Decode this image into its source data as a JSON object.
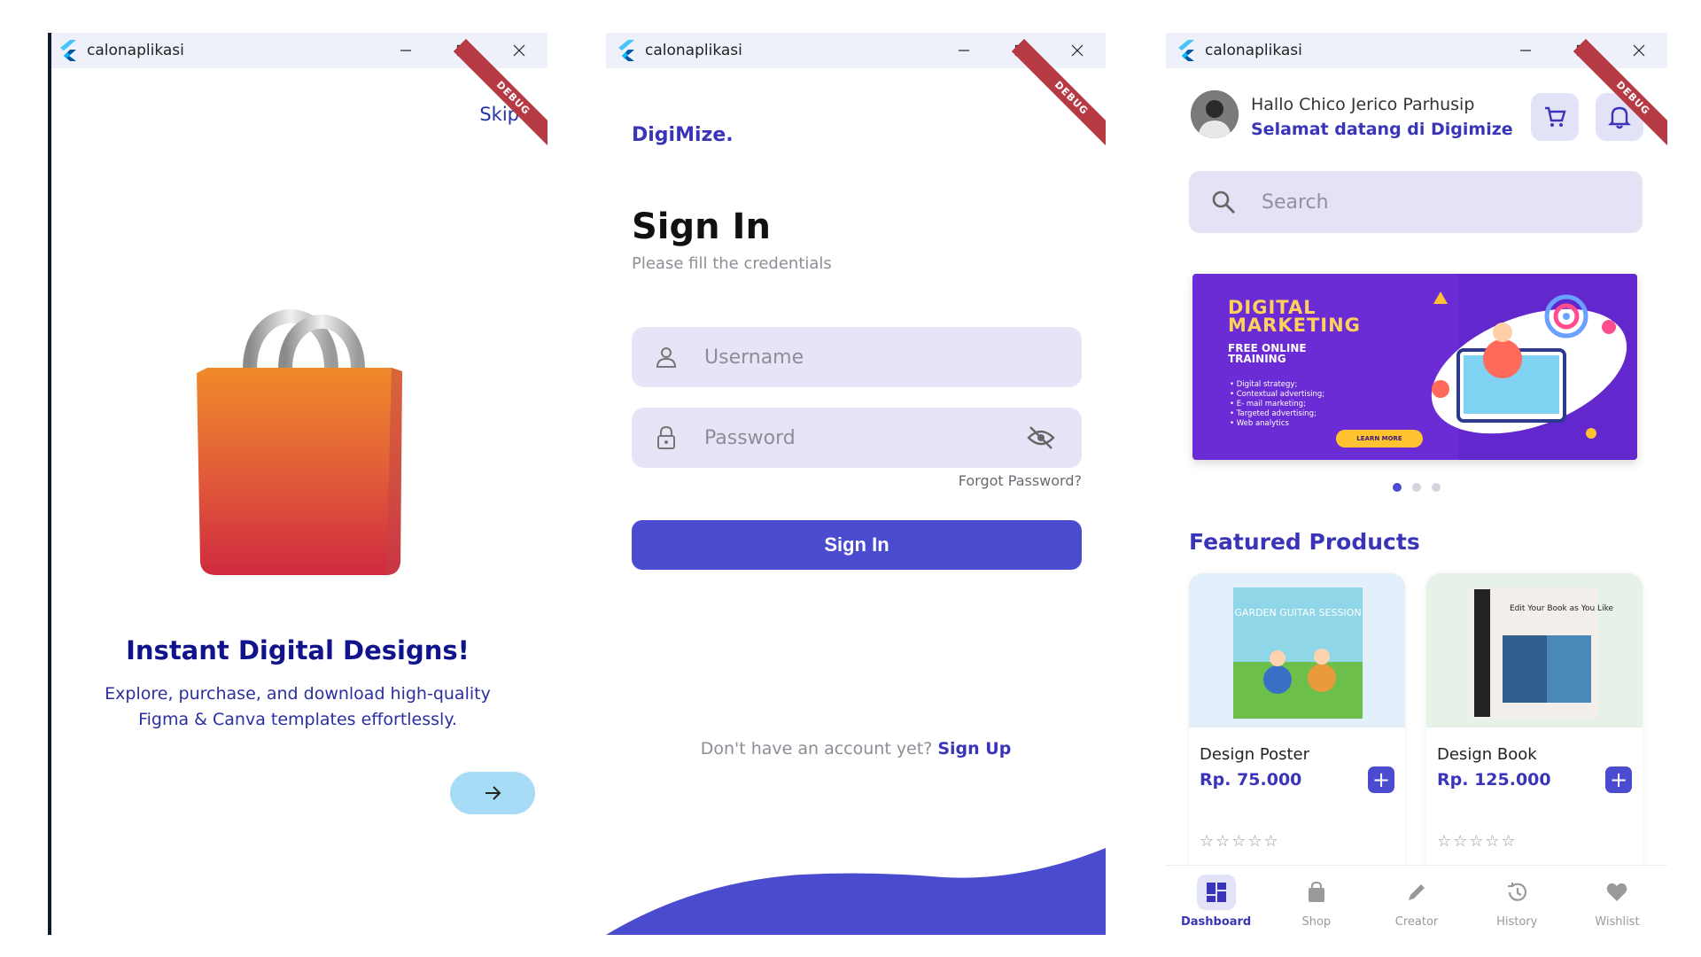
{
  "windows": [
    {
      "title": "calonaplikasi",
      "debug_label": "DEBUG",
      "onboarding": {
        "skip_label": "Skip",
        "title": "Instant Digital Designs!",
        "description": "Explore, purchase, and download high-quality Figma & Canva templates effortlessly.",
        "next_icon": "arrow-right-icon"
      }
    },
    {
      "title": "calonaplikasi",
      "debug_label": "DEBUG",
      "signin": {
        "brand": "DigiMize.",
        "title": "Sign In",
        "subtitle": "Please fill the credentials",
        "username_placeholder": "Username",
        "password_placeholder": "Password",
        "forgot_label": "Forgot Password?",
        "submit_label": "Sign In",
        "no_account_text": "Don't have an account yet?",
        "signup_label": "Sign Up"
      }
    },
    {
      "title": "calonaplikasi",
      "debug_label": "DEBUG",
      "dashboard": {
        "greeting": "Hallo Chico Jerico Parhusip",
        "welcome": "Selamat datang di Digimize",
        "search_placeholder": "Search",
        "banner": {
          "title_line1": "DIGITAL",
          "title_line2": "MARKETING",
          "subtitle_line1": "FREE ONLINE",
          "subtitle_line2": "TRAINING",
          "bullets": [
            "Digital strategy;",
            "Contextual advertising;",
            "E- mail marketing;",
            "Targeted advertising;",
            "Web analytics"
          ],
          "button": "LEARN MORE"
        },
        "carousel_active_index": 0,
        "featured_title": "Featured Products",
        "products": [
          {
            "name": "Design Poster",
            "price": "Rp. 75.000",
            "thumb_text": "GARDEN GUITAR SESSION",
            "rating": 0
          },
          {
            "name": "Design Book",
            "price": "Rp. 125.000",
            "thumb_text": "Edit Your Book as You Like",
            "rating": 0
          }
        ],
        "nav": [
          {
            "label": "Dashboard",
            "icon": "dashboard-icon",
            "active": true
          },
          {
            "label": "Shop",
            "icon": "shopping-bag-icon",
            "active": false
          },
          {
            "label": "Creator",
            "icon": "pencil-icon",
            "active": false
          },
          {
            "label": "History",
            "icon": "history-icon",
            "active": false
          },
          {
            "label": "Wishlist",
            "icon": "heart-icon",
            "active": false
          }
        ]
      }
    }
  ],
  "colors": {
    "primary": "#4b4bcf",
    "brand_text": "#3a35b8",
    "field_bg": "#e6e5f7",
    "titlebar_bg": "#eef1f9",
    "debug_ribbon": "#b53a44"
  }
}
